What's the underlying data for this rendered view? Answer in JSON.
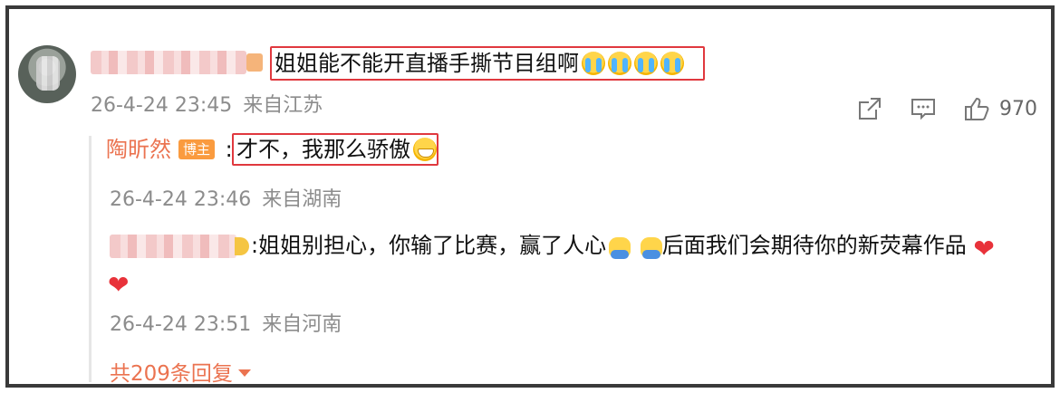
{
  "main_comment": {
    "text": "姐姐能不能开直播手撕节目组啊",
    "emojis": [
      "crying-emoji",
      "crying-emoji",
      "crying-emoji",
      "crying-emoji"
    ],
    "date": "26-4-24 23:45",
    "location": "来自江苏",
    "actions": {
      "share_icon": "share-icon",
      "comment_icon": "comment-icon",
      "like_icon": "thumbs-up-icon",
      "like_count": "970"
    }
  },
  "replies": [
    {
      "author": "陶昕然",
      "badge": "博主",
      "separator": ":",
      "text": "才不，我那么骄傲",
      "emoji": "grin-emoji",
      "date": "26-4-24 23:46",
      "location": "来自湖南"
    },
    {
      "text_part1": ":姐姐别担心，你输了比赛，赢了人心",
      "text_part2": "后面我们会期待你的新荧幕作品",
      "date": "26-4-24 23:51",
      "location": "来自河南"
    }
  ],
  "more_replies": "共209条回复",
  "colors": {
    "accent": "#eb7350",
    "highlight_box": "#e0383e",
    "badge": "#fa9b3f",
    "heart": "#e8323a"
  }
}
